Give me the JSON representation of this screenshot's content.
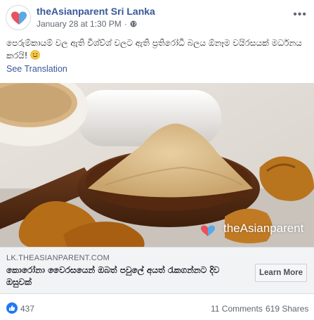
{
  "post": {
    "page_name": "theAsianparent Sri Lanka",
    "timestamp": "January 28 at 1:30 PM",
    "dot": "·",
    "text": "පෙරුම්කායම් වල ඇති විශ්ව්ශ් වලට ඇති ප්‍රතිරෝධී බලය ඕනෑම වයිරසයක් මර්ධනය කරයි!",
    "see_translation": "See Translation"
  },
  "image": {
    "watermark": "theAsianparent"
  },
  "link_preview": {
    "domain": "LK.THEASIANPARENT.COM",
    "title": "කොරෝනා වෛරසයෙන් ඔබත් පවුලේ අයත් රැකගන්නට දිව ඔසුවක්",
    "button_label": "Learn More"
  },
  "footer": {
    "reaction_count": "437",
    "comments": "11 Comments",
    "shares": "619 Shares"
  },
  "colors": {
    "link_blue": "#385898",
    "like_blue": "#2078f4",
    "brand_red": "#e8525b"
  }
}
